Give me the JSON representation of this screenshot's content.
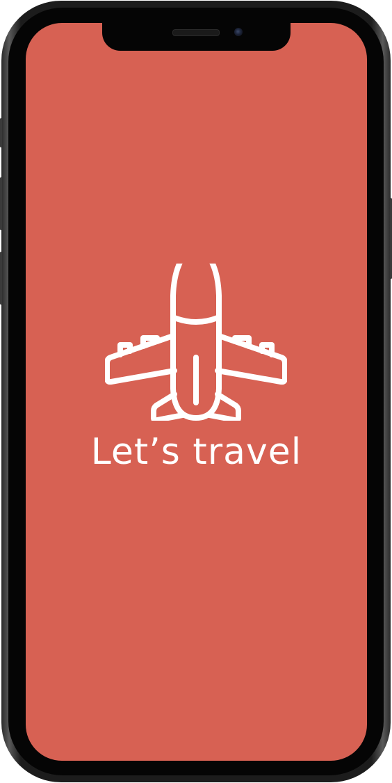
{
  "splash": {
    "title": "Let’s travel",
    "icon": "airplane-icon"
  },
  "colors": {
    "screen_background": "#d76153",
    "foreground": "#ffffff"
  }
}
